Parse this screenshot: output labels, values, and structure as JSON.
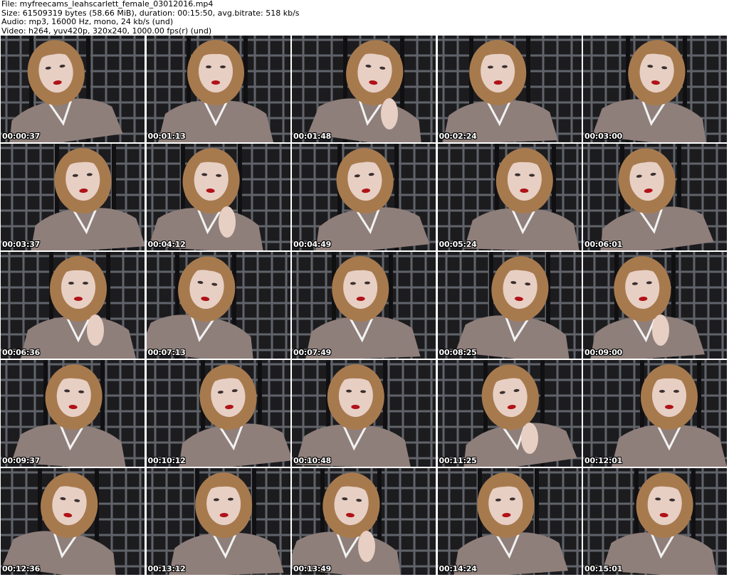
{
  "header": {
    "file": "File: myfreecams_leahscarlett_female_03012016.mp4",
    "size": "Size: 61509319 bytes (58.66 MiB), duration: 00:15:50, avg.bitrate: 518 kb/s",
    "audio": "Audio: mp3, 16000 Hz, mono, 24 kb/s (und)",
    "video": "Video: h264, yuv420p, 320x240, 1000.00 fps(r) (und)"
  },
  "thumbnails": [
    {
      "time": "00:00:37"
    },
    {
      "time": "00:01:13"
    },
    {
      "time": "00:01:48"
    },
    {
      "time": "00:02:24"
    },
    {
      "time": "00:03:00"
    },
    {
      "time": "00:03:37"
    },
    {
      "time": "00:04:12"
    },
    {
      "time": "00:04:49"
    },
    {
      "time": "00:05:24"
    },
    {
      "time": "00:06:01"
    },
    {
      "time": "00:06:36"
    },
    {
      "time": "00:07:13"
    },
    {
      "time": "00:07:49"
    },
    {
      "time": "00:08:25"
    },
    {
      "time": "00:09:00"
    },
    {
      "time": "00:09:37"
    },
    {
      "time": "00:10:12"
    },
    {
      "time": "00:10:48"
    },
    {
      "time": "00:11:25"
    },
    {
      "time": "00:12:01"
    },
    {
      "time": "00:12:36"
    },
    {
      "time": "00:13:12"
    },
    {
      "time": "00:13:49"
    },
    {
      "time": "00:14:24"
    },
    {
      "time": "00:15:01"
    }
  ],
  "colors": {
    "background": "#ffffff",
    "screen_dark": "#1c1c1f",
    "screen_grid": "#6e7078",
    "shirt": "#8f7f7a",
    "hair": "#a77a4e",
    "skin": "#e7cfc4",
    "lips": "#b01218"
  }
}
